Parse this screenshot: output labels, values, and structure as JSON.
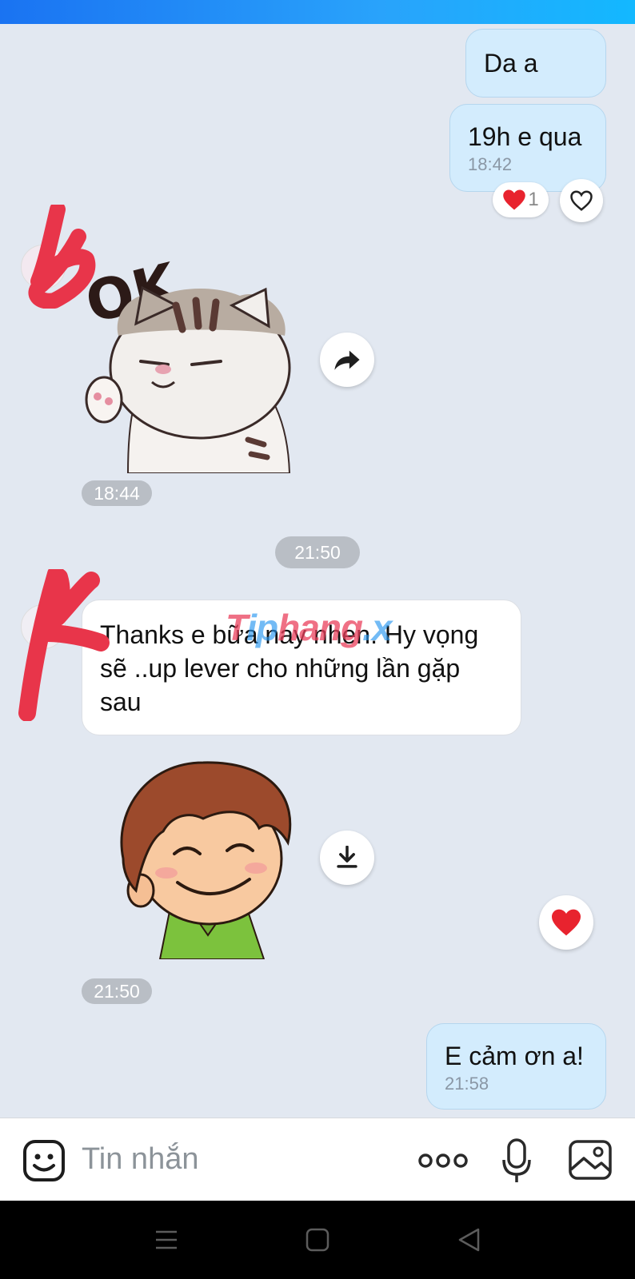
{
  "messages": {
    "msg1": {
      "text": "Da a"
    },
    "msg2": {
      "text": "19h e qua",
      "time": "18:42",
      "reaction_count": "1"
    },
    "sticker1": {
      "time": "18:44",
      "caption": "OK"
    },
    "divider": {
      "time": "21:50"
    },
    "msg3": {
      "line1": "Thanks e bữa nay nhen. Hy vọng",
      "line2": "sẽ ..up lever cho những lần gặp",
      "line3": "sau"
    },
    "sticker2": {
      "time": "21:50"
    },
    "msg4": {
      "text": "E cảm ơn a!",
      "time": "21:58"
    }
  },
  "watermark": {
    "part1": "T",
    "part2": "ip",
    "part3": "hang",
    "part4": ".x"
  },
  "input": {
    "placeholder": "Tin nhắn"
  },
  "colors": {
    "background": "#e2e8f1",
    "my_bubble": "#d3ecfd",
    "their_bubble": "#ffffff",
    "accent": "#1a73f2",
    "heart": "#e8232e",
    "scribble": "#e8354a"
  },
  "icons": [
    "sticker-icon",
    "more-icon",
    "mic-icon",
    "image-icon",
    "forward-icon",
    "download-icon",
    "heart-icon",
    "menu-icon",
    "home-icon",
    "back-icon"
  ]
}
